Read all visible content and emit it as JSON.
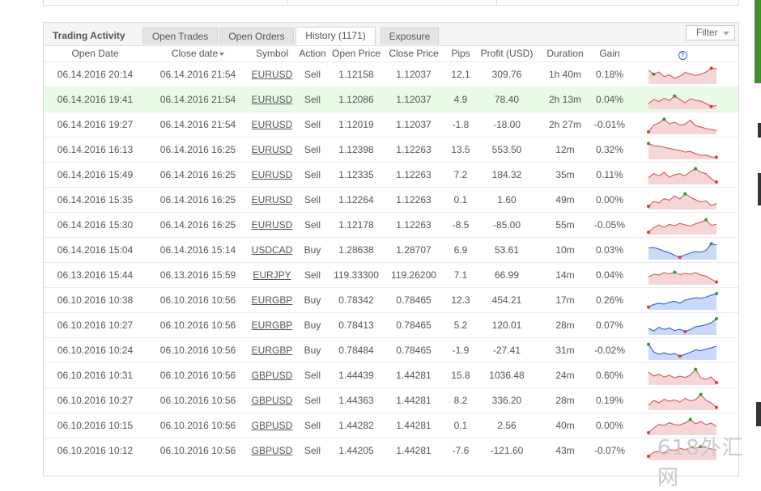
{
  "panel": {
    "title": "Trading Activity",
    "tabs": [
      {
        "label": "Open Trades"
      },
      {
        "label": "Open Orders"
      },
      {
        "label": "History (1171)",
        "active": true
      },
      {
        "label": "Exposure"
      }
    ],
    "filter_label": "Filter"
  },
  "columns": [
    "Open Date",
    "Close date",
    "Symbol",
    "Action",
    "Open Price",
    "Close Price",
    "Pips",
    "Profit (USD)",
    "Duration",
    "Gain"
  ],
  "colors": {
    "positive": "#2e9a34",
    "negative": "#e23a3a",
    "sell_chart": "#f4d6d6",
    "buy_chart": "#c9daf8"
  },
  "watermark": "618外汇网",
  "rows": [
    {
      "open": "06.14.2016 20:14",
      "close": "06.14.2016 21:54",
      "symbol": "EURUSD",
      "action": "Sell",
      "open_price": "1.12158",
      "close_price": "1.12037",
      "pips": "12.1",
      "profit": "309.76",
      "duration": "1h 40m",
      "gain": "0.18%",
      "sign": "pos",
      "chart": [
        0.82,
        0.56,
        0.7,
        0.42,
        0.52,
        0.32,
        0.44,
        0.67,
        0.58,
        0.49,
        0.56,
        0.7,
        0.93,
        0.9
      ],
      "max_i": 1,
      "min_i": 12
    },
    {
      "open": "06.14.2016 19:41",
      "close": "06.14.2016 21:54",
      "symbol": "EURUSD",
      "action": "Sell",
      "open_price": "1.12086",
      "close_price": "1.12037",
      "pips": "4.9",
      "profit": "78.40",
      "duration": "2h 13m",
      "gain": "0.04%",
      "sign": "pos",
      "chart": [
        0.3,
        0.55,
        0.42,
        0.62,
        0.48,
        0.76,
        0.56,
        0.35,
        0.6,
        0.5,
        0.45,
        0.3,
        0.12,
        0.18
      ],
      "max_i": 5,
      "min_i": 12,
      "highlight": true
    },
    {
      "open": "06.14.2016 19:27",
      "close": "06.14.2016 21:54",
      "symbol": "EURUSD",
      "action": "Sell",
      "open_price": "1.12019",
      "close_price": "1.12037",
      "pips": "-1.8",
      "profit": "-18.00",
      "duration": "2h 27m",
      "gain": "-0.01%",
      "sign": "neg",
      "chart": [
        0.1,
        0.52,
        0.66,
        0.88,
        0.6,
        0.7,
        0.52,
        0.58,
        0.82,
        0.48,
        0.4,
        0.3,
        0.24,
        0.18
      ],
      "max_i": 3,
      "min_i": 0
    },
    {
      "open": "06.14.2016 16:13",
      "close": "06.14.2016 16:25",
      "symbol": "EURUSD",
      "action": "Sell",
      "open_price": "1.12398",
      "close_price": "1.12263",
      "pips": "13.5",
      "profit": "553.50",
      "duration": "12m",
      "gain": "0.32%",
      "sign": "pos",
      "chart": [
        0.93,
        0.8,
        0.76,
        0.7,
        0.62,
        0.56,
        0.5,
        0.4,
        0.44,
        0.3,
        0.2,
        0.22,
        0.1,
        0.08
      ],
      "max_i": 0,
      "min_i": 13
    },
    {
      "open": "06.14.2016 15:49",
      "close": "06.14.2016 16:25",
      "symbol": "EURUSD",
      "action": "Sell",
      "open_price": "1.12335",
      "close_price": "1.12263",
      "pips": "7.2",
      "profit": "184.32",
      "duration": "35m",
      "gain": "0.11%",
      "sign": "pos",
      "chart": [
        0.36,
        0.62,
        0.48,
        0.7,
        0.4,
        0.55,
        0.62,
        0.48,
        0.75,
        0.92,
        0.7,
        0.62,
        0.3,
        0.1
      ],
      "max_i": 9,
      "min_i": 13
    },
    {
      "open": "06.14.2016 15:35",
      "close": "06.14.2016 16:25",
      "symbol": "EURUSD",
      "action": "Sell",
      "open_price": "1.12264",
      "close_price": "1.12263",
      "pips": "0.1",
      "profit": "1.60",
      "duration": "49m",
      "gain": "0.00%",
      "sign": "pos",
      "chart": [
        0.15,
        0.45,
        0.36,
        0.62,
        0.52,
        0.8,
        0.6,
        0.92,
        0.72,
        0.55,
        0.42,
        0.48,
        0.2,
        0.32
      ],
      "max_i": 7,
      "min_i": 0
    },
    {
      "open": "06.14.2016 15:30",
      "close": "06.14.2016 16:25",
      "symbol": "EURUSD",
      "action": "Sell",
      "open_price": "1.12178",
      "close_price": "1.12263",
      "pips": "-8.5",
      "profit": "-85.00",
      "duration": "55m",
      "gain": "-0.05%",
      "sign": "neg",
      "chart": [
        0.1,
        0.38,
        0.55,
        0.4,
        0.58,
        0.5,
        0.64,
        0.55,
        0.48,
        0.62,
        0.72,
        0.86,
        0.52,
        0.58
      ],
      "max_i": 11,
      "min_i": 0
    },
    {
      "open": "06.14.2016 15:04",
      "close": "06.14.2016 15:14",
      "symbol": "USDCAD",
      "action": "Buy",
      "open_price": "1.28638",
      "close_price": "1.28707",
      "pips": "6.9",
      "profit": "53.61",
      "duration": "10m",
      "gain": "0.03%",
      "sign": "pos",
      "chart": [
        0.68,
        0.7,
        0.6,
        0.48,
        0.38,
        0.22,
        0.1,
        0.26,
        0.36,
        0.45,
        0.42,
        0.52,
        0.93,
        0.86
      ],
      "max_i": 12,
      "min_i": 6
    },
    {
      "open": "06.13.2016 15:44",
      "close": "06.13.2016 15:59",
      "symbol": "EURJPY",
      "action": "Sell",
      "open_price": "119.33300",
      "close_price": "119.26200",
      "pips": "7.1",
      "profit": "66.99",
      "duration": "14m",
      "gain": "0.04%",
      "sign": "pos",
      "chart": [
        0.42,
        0.6,
        0.55,
        0.7,
        0.62,
        0.72,
        0.58,
        0.65,
        0.6,
        0.7,
        0.55,
        0.48,
        0.3,
        0.12
      ],
      "max_i": 5,
      "min_i": 13
    },
    {
      "open": "06.10.2016 10:38",
      "close": "06.10.2016 10:56",
      "symbol": "EURGBP",
      "action": "Buy",
      "open_price": "0.78342",
      "close_price": "0.78465",
      "pips": "12.3",
      "profit": "454.21",
      "duration": "17m",
      "gain": "0.26%",
      "sign": "pos",
      "chart": [
        0.12,
        0.28,
        0.36,
        0.3,
        0.42,
        0.48,
        0.36,
        0.55,
        0.62,
        0.7,
        0.66,
        0.74,
        0.85,
        0.95
      ],
      "max_i": 13,
      "min_i": 0
    },
    {
      "open": "06.10.2016 10:27",
      "close": "06.10.2016 10:56",
      "symbol": "EURGBP",
      "action": "Buy",
      "open_price": "0.78413",
      "close_price": "0.78465",
      "pips": "5.2",
      "profit": "120.01",
      "duration": "28m",
      "gain": "0.07%",
      "sign": "pos",
      "chart": [
        0.35,
        0.2,
        0.42,
        0.28,
        0.38,
        0.22,
        0.3,
        0.15,
        0.28,
        0.45,
        0.5,
        0.58,
        0.7,
        0.95
      ],
      "max_i": 13,
      "min_i": 7
    },
    {
      "open": "06.10.2016 10:24",
      "close": "06.10.2016 10:56",
      "symbol": "EURGBP",
      "action": "Buy",
      "open_price": "0.78484",
      "close_price": "0.78465",
      "pips": "-1.9",
      "profit": "-27.41",
      "duration": "31m",
      "gain": "-0.02%",
      "sign": "neg",
      "chart": [
        0.92,
        0.45,
        0.3,
        0.4,
        0.28,
        0.35,
        0.18,
        0.3,
        0.42,
        0.58,
        0.52,
        0.62,
        0.7,
        0.8
      ],
      "max_i": 0,
      "min_i": 6
    },
    {
      "open": "06.10.2016 10:31",
      "close": "06.10.2016 10:56",
      "symbol": "GBPUSD",
      "action": "Sell",
      "open_price": "1.44439",
      "close_price": "1.44281",
      "pips": "15.8",
      "profit": "1036.48",
      "duration": "24m",
      "gain": "0.60%",
      "sign": "pos",
      "chart": [
        0.75,
        0.5,
        0.62,
        0.45,
        0.55,
        0.4,
        0.5,
        0.42,
        0.55,
        0.92,
        0.4,
        0.3,
        0.45,
        0.1
      ],
      "max_i": 9,
      "min_i": 13
    },
    {
      "open": "06.10.2016 10:27",
      "close": "06.10.2016 10:56",
      "symbol": "GBPUSD",
      "action": "Sell",
      "open_price": "1.44363",
      "close_price": "1.44281",
      "pips": "8.2",
      "profit": "336.20",
      "duration": "28m",
      "gain": "0.19%",
      "sign": "pos",
      "chart": [
        0.25,
        0.55,
        0.4,
        0.62,
        0.5,
        0.58,
        0.45,
        0.68,
        0.52,
        0.6,
        0.92,
        0.55,
        0.4,
        0.12
      ],
      "max_i": 10,
      "min_i": 13
    },
    {
      "open": "06.10.2016 10:15",
      "close": "06.10.2016 10:56",
      "symbol": "GBPUSD",
      "action": "Sell",
      "open_price": "1.44282",
      "close_price": "1.44281",
      "pips": "0.1",
      "profit": "2.56",
      "duration": "40m",
      "gain": "0.00%",
      "sign": "pos",
      "chart": [
        0.1,
        0.4,
        0.62,
        0.55,
        0.72,
        0.6,
        0.58,
        0.7,
        0.92,
        0.65,
        0.8,
        0.6,
        0.7,
        0.5
      ],
      "max_i": 8,
      "min_i": 0
    },
    {
      "open": "06.10.2016 10:12",
      "close": "06.10.2016 10:56",
      "symbol": "GBPUSD",
      "action": "Sell",
      "open_price": "1.44205",
      "close_price": "1.44281",
      "pips": "-7.6",
      "profit": "-121.60",
      "duration": "43m",
      "gain": "-0.07%",
      "sign": "neg",
      "chart": [
        0.2,
        0.45,
        0.5,
        0.4,
        0.62,
        0.55,
        0.7,
        0.6,
        0.75,
        0.68,
        0.8,
        0.72,
        0.65,
        0.6
      ],
      "max_i": 10,
      "min_i": 0
    }
  ]
}
